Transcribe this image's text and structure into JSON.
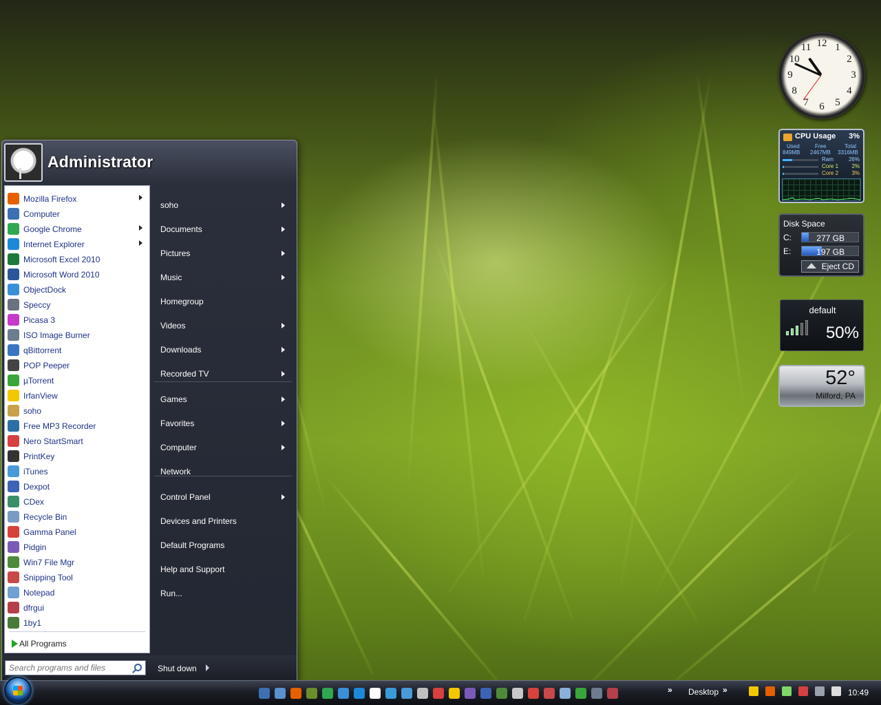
{
  "user": {
    "name": "Administrator"
  },
  "programs": [
    {
      "label": "Mozilla Firefox",
      "icon": "firefox-icon",
      "color": "#e66000",
      "has_arrow": true
    },
    {
      "label": "Computer",
      "icon": "computer-icon",
      "color": "#3d6fb3",
      "has_arrow": false
    },
    {
      "label": "Google Chrome",
      "icon": "chrome-icon",
      "color": "#2fa84f",
      "has_arrow": true
    },
    {
      "label": "Internet Explorer",
      "icon": "ie-icon",
      "color": "#1e88d8",
      "has_arrow": true
    },
    {
      "label": "Microsoft Excel 2010",
      "icon": "excel-icon",
      "color": "#1f7a3a",
      "has_arrow": false
    },
    {
      "label": "Microsoft Word 2010",
      "icon": "word-icon",
      "color": "#2b579a",
      "has_arrow": false
    },
    {
      "label": "ObjectDock",
      "icon": "objectdock-icon",
      "color": "#3b8fd9",
      "has_arrow": false
    },
    {
      "label": "Speccy",
      "icon": "speccy-icon",
      "color": "#6a7280",
      "has_arrow": false
    },
    {
      "label": "Picasa 3",
      "icon": "picasa-icon",
      "color": "#c53ac8",
      "has_arrow": false
    },
    {
      "label": "ISO Image Burner",
      "icon": "iso-burner-icon",
      "color": "#6d7c8e",
      "has_arrow": false
    },
    {
      "label": "qBittorrent",
      "icon": "qbittorrent-icon",
      "color": "#3a75c4",
      "has_arrow": false
    },
    {
      "label": "POP Peeper",
      "icon": "pop-peeper-icon",
      "color": "#444444",
      "has_arrow": false
    },
    {
      "label": "µTorrent",
      "icon": "utorrent-icon",
      "color": "#3aa53a",
      "has_arrow": false
    },
    {
      "label": "IrfanView",
      "icon": "irfanview-icon",
      "color": "#f2c800",
      "has_arrow": false
    },
    {
      "label": "soho",
      "icon": "soho-icon",
      "color": "#c8a24a",
      "has_arrow": false
    },
    {
      "label": "Free MP3 Recorder",
      "icon": "mp3-recorder-icon",
      "color": "#2d6fa3",
      "has_arrow": false
    },
    {
      "label": "Nero StartSmart",
      "icon": "nero-icon",
      "color": "#d64040",
      "has_arrow": false
    },
    {
      "label": "PrintKey",
      "icon": "printkey-icon",
      "color": "#333333",
      "has_arrow": false
    },
    {
      "label": "iTunes",
      "icon": "itunes-icon",
      "color": "#4a9ad8",
      "has_arrow": false
    },
    {
      "label": "Dexpot",
      "icon": "dexpot-icon",
      "color": "#3c63b5",
      "has_arrow": false
    },
    {
      "label": "CDex",
      "icon": "cdex-icon",
      "color": "#3a8f6a",
      "has_arrow": false
    },
    {
      "label": "Recycle Bin",
      "icon": "recycle-bin-icon",
      "color": "#7a9cc4",
      "has_arrow": false
    },
    {
      "label": "Gamma Panel",
      "icon": "gamma-panel-icon",
      "color": "#d7423a",
      "has_arrow": false
    },
    {
      "label": "Pidgin",
      "icon": "pidgin-icon",
      "color": "#7a5ab8",
      "has_arrow": false
    },
    {
      "label": "Win7 File Mgr",
      "icon": "file-manager-icon",
      "color": "#4e8a3a",
      "has_arrow": false
    },
    {
      "label": "Snipping Tool",
      "icon": "snipping-tool-icon",
      "color": "#c94848",
      "has_arrow": false
    },
    {
      "label": "Notepad",
      "icon": "notepad-icon",
      "color": "#6fa0cf",
      "has_arrow": false
    },
    {
      "label": "dfrgui",
      "icon": "defrag-icon",
      "color": "#b3404a",
      "has_arrow": false
    },
    {
      "label": "1by1",
      "icon": "1by1-icon",
      "color": "#4a7a3a",
      "has_arrow": false
    }
  ],
  "all_programs": "All Programs",
  "places": [
    {
      "label": "soho",
      "has_arrow": true
    },
    {
      "label": "Documents",
      "has_arrow": true
    },
    {
      "label": "Pictures",
      "has_arrow": true
    },
    {
      "label": "Music",
      "has_arrow": true
    },
    {
      "label": "Homegroup",
      "has_arrow": false
    },
    {
      "label": "Videos",
      "has_arrow": true
    },
    {
      "label": "Downloads",
      "has_arrow": true
    },
    {
      "label": "Recorded TV",
      "has_arrow": true
    },
    {
      "label": "Games",
      "has_arrow": true
    },
    {
      "label": "Favorites",
      "has_arrow": true
    },
    {
      "label": "Computer",
      "has_arrow": true
    },
    {
      "label": "Network",
      "has_arrow": false
    },
    {
      "label": "Control Panel",
      "has_arrow": true
    },
    {
      "label": "Devices and Printers",
      "has_arrow": false
    },
    {
      "label": "Default Programs",
      "has_arrow": false
    },
    {
      "label": "Help and Support",
      "has_arrow": false
    },
    {
      "label": "Run...",
      "has_arrow": false
    }
  ],
  "search": {
    "placeholder": "Search programs and files"
  },
  "shutdown": "Shut down",
  "taskbar": {
    "quicklaunch_colors": [
      "#3d6fb3",
      "#5a8fd0",
      "#e66000",
      "#6b8e2a",
      "#2fa84f",
      "#3b8fd9",
      "#1e88d8",
      "#ffffff",
      "#3a9ad8",
      "#4a9ad8",
      "#c0c0c0",
      "#d64040",
      "#f2c800",
      "#7a5ab8",
      "#3c63b5",
      "#4e8a3a",
      "#c8c8c8",
      "#d7423a",
      "#c94848",
      "#8ab0d8",
      "#3aa53a",
      "#6d7c8e",
      "#b3404a"
    ],
    "desktop_label": "Desktop",
    "tray_colors": [
      "#f2c800",
      "#e66000",
      "#7fd66a",
      "#d64040",
      "#9aa2ad",
      "#dddddd"
    ],
    "time": "10:49"
  },
  "gadgets": {
    "clock": {
      "hour": 10,
      "minute": 49,
      "second": 36
    },
    "cpu": {
      "title": "CPU Usage",
      "percent": "3%",
      "used_label": "Used",
      "free_label": "Free",
      "total_label": "Total",
      "used": "849MB",
      "free": "2467MB",
      "total": "3316MB",
      "ram_label": "Ram",
      "ram_pct": "26%",
      "ram_fraction": 0.26,
      "core1_label": "Core 1",
      "core1_pct": "2%",
      "core1_fraction": 0.02,
      "core2_label": "Core 2",
      "core2_pct": "3%",
      "core2_fraction": 0.03
    },
    "disk": {
      "title": "Disk Space",
      "drives": [
        {
          "label": "C:",
          "value": "277 GB",
          "used_fraction": 0.12
        },
        {
          "label": "E:",
          "value": "197 GB",
          "used_fraction": 0.35
        }
      ],
      "eject_label": "Eject CD"
    },
    "wifi": {
      "name": "default",
      "percent": "50%",
      "bars_lit": 3,
      "bars_total": 5
    },
    "weather": {
      "temp": "52°",
      "city": "Milford, PA"
    }
  }
}
